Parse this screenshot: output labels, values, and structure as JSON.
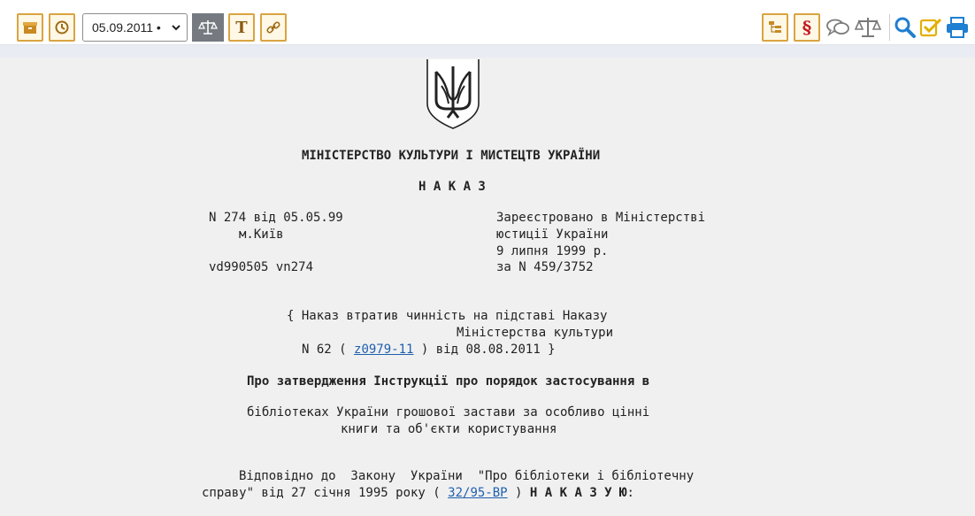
{
  "toolbar": {
    "date_value": "05.09.2011 •",
    "text_button_glyph": "T",
    "icons": [
      "archive-icon",
      "history-icon",
      "scales-icon",
      "text-icon",
      "link-icon",
      "structure-icon",
      "paragraph-icon",
      "comments-icon",
      "compare-icon",
      "search-icon",
      "check-icon",
      "print-icon"
    ],
    "accent_color": "#d9a441",
    "blue_color": "#1f7fd0"
  },
  "document": {
    "ministry": "МІНІСТЕРСТВО КУЛЬТУРИ І МИСТЕЦТВ УКРАЇНИ",
    "doc_type": "Н А К А З",
    "number_date": "N 274 від 05.05.99",
    "city": "м.Київ",
    "code": "vd990505 vn274",
    "reg_line1": "Зареєстровано в Міністерстві",
    "reg_line2": "юстиції України",
    "reg_line3": "9 липня 1999 р.",
    "reg_line4": "за N 459/3752",
    "note_line1": "{ Наказ втратив чинність на підставі Наказу",
    "note_line2": "Міністерства культури",
    "note_line3_pre": "N 62 ( ",
    "note_link": "z0979-11",
    "note_line3_post": " ) від 08.08.2011 }",
    "title_line1": "Про затвердження Інструкції про порядок застосування в",
    "title_line2": "бібліотеках України грошової застави за особливо цінні",
    "title_line3": "книги та об'єкти користування",
    "body_line1": "Відповідно до  Закону  України  \"Про бібліотеки і бібліотечну",
    "body_line2_pre": "справу\" від 27 січня 1995 року ( ",
    "body_link": "32/95-ВР",
    "body_line2_mid": " ) ",
    "body_line2_bold": "Н А К А З У Ю",
    "body_line2_end": ":"
  }
}
